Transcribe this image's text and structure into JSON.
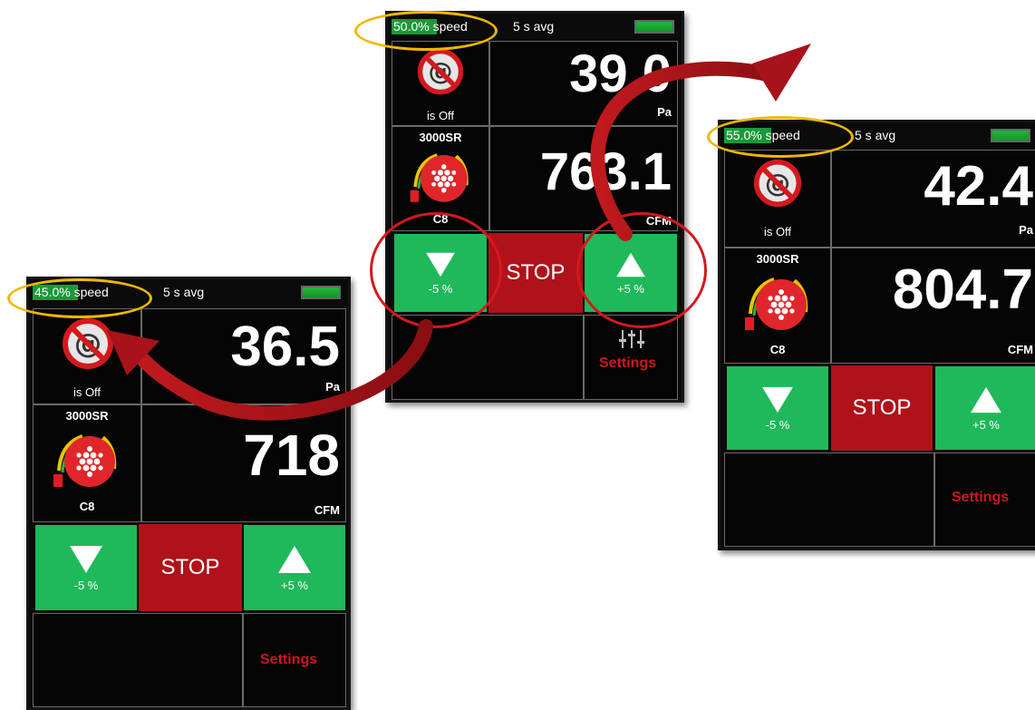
{
  "colors": {
    "green_button": "#1fb85a",
    "stop_button": "#b0121a",
    "speed_fill": "#1a9a3a",
    "settings_text": "#c8191e",
    "highlight_oval": "#f0b800",
    "highlight_circle": "#d4191e",
    "flow_arrow": "#a8121a"
  },
  "icons": {
    "controller_status": "at-sign-prohibited-icon",
    "fan": "fan-3000sr-icon",
    "decrease": "triangle-down-icon",
    "increase": "triangle-up-icon",
    "settings": "sliders-icon"
  },
  "screens": [
    {
      "speed_text": "45.0%",
      "speed_word": "speed",
      "speed_fraction": 0.45,
      "avg_text": "5 s avg",
      "controller_status": "is Off",
      "pressure_value": "36.5",
      "pressure_unit": "Pa",
      "fan_model": "3000SR",
      "fan_ring": "C8",
      "flow_value": "718",
      "flow_unit": "CFM",
      "down_label": "-5 %",
      "stop_label": "STOP",
      "up_label": "+5 %",
      "settings_label": "Settings"
    },
    {
      "speed_text": "50.0%",
      "speed_word": "speed",
      "speed_fraction": 0.5,
      "avg_text": "5 s avg",
      "controller_status": "is Off",
      "pressure_value": "39.0",
      "pressure_unit": "Pa",
      "fan_model": "3000SR",
      "fan_ring": "C8",
      "flow_value": "763.1",
      "flow_unit": "CFM",
      "down_label": "-5 %",
      "stop_label": "STOP",
      "up_label": "+5 %",
      "settings_label": "Settings"
    },
    {
      "speed_text": "55.0%",
      "speed_word": "speed",
      "speed_fraction": 0.55,
      "avg_text": "5 s avg",
      "controller_status": "is Off",
      "pressure_value": "42.4",
      "pressure_unit": "Pa",
      "fan_model": "3000SR",
      "fan_ring": "C8",
      "flow_value": "804.7",
      "flow_unit": "CFM",
      "down_label": "-5 %",
      "stop_label": "STOP",
      "up_label": "+5 %",
      "settings_label": "Settings"
    }
  ]
}
